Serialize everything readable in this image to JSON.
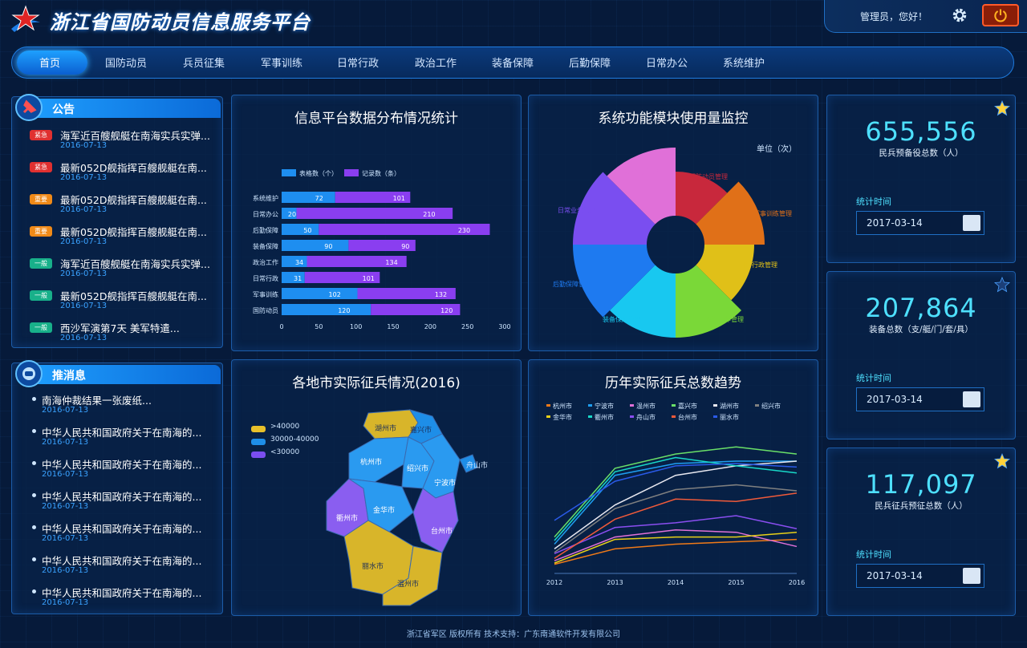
{
  "header": {
    "title": "浙江省国防动员信息服务平台",
    "greeting": "管理员，您好！"
  },
  "nav": {
    "items": [
      "首页",
      "国防动员",
      "兵员征集",
      "军事训练",
      "日常行政",
      "政治工作",
      "装备保障",
      "后勤保障",
      "日常办公",
      "系统维护"
    ]
  },
  "notices": {
    "title": "公告",
    "items": [
      {
        "badge": "紧急",
        "badge_color": "#e03030",
        "title": "海军近百艘舰艇在南海实兵实弹...",
        "date": "2016-07-13"
      },
      {
        "badge": "紧急",
        "badge_color": "#e03030",
        "title": "最新052D舰指挥百艘舰艇在南...",
        "date": "2016-07-13"
      },
      {
        "badge": "重要",
        "badge_color": "#f08a18",
        "title": "最新052D舰指挥百艘舰艇在南...",
        "date": "2016-07-13"
      },
      {
        "badge": "重要",
        "badge_color": "#f08a18",
        "title": "最新052D舰指挥百艘舰艇在南...",
        "date": "2016-07-13"
      },
      {
        "badge": "一般",
        "badge_color": "#18b08a",
        "title": "海军近百艘舰艇在南海实兵实弹...",
        "date": "2016-07-13"
      },
      {
        "badge": "一般",
        "badge_color": "#18b08a",
        "title": "最新052D舰指挥百艘舰艇在南...",
        "date": "2016-07-13"
      },
      {
        "badge": "一般",
        "badge_color": "#18b08a",
        "title": "西沙军演第7天 美军特遣...",
        "date": "2016-07-13"
      }
    ]
  },
  "push": {
    "title": "推消息",
    "items": [
      {
        "title": "南海仲裁结果一张废纸...",
        "date": "2016-07-13"
      },
      {
        "title": "中华人民共和国政府关于在南海的...",
        "date": "2016-07-13"
      },
      {
        "title": "中华人民共和国政府关于在南海的...",
        "date": "2016-07-13"
      },
      {
        "title": "中华人民共和国政府关于在南海的...",
        "date": "2016-07-13"
      },
      {
        "title": "中华人民共和国政府关于在南海的...",
        "date": "2016-07-13"
      },
      {
        "title": "中华人民共和国政府关于在南海的...",
        "date": "2016-07-13"
      },
      {
        "title": "中华人民共和国政府关于在南海的...",
        "date": "2016-07-13"
      }
    ]
  },
  "panels": {
    "bar_title": "信息平台数据分布情况统计",
    "rose_title": "系统功能模块使用量监控",
    "rose_unit": "单位（次）",
    "map_title": "各地市实际征兵情况(2016)",
    "line_title": "历年实际征兵总数趋势"
  },
  "stats": [
    {
      "value": "655,556",
      "label": "民兵预备役总数（人）",
      "time_label": "统计时间",
      "date": "2017-03-14",
      "star_color": "#ffd23a"
    },
    {
      "value": "207,864",
      "label": "装备总数（支/艇/门/套/具）",
      "time_label": "统计时间",
      "date": "2017-03-14",
      "star_color": "#1c3f78"
    },
    {
      "value": "117,097",
      "label": "民兵征兵预征总数（人）",
      "time_label": "统计时间",
      "date": "2017-03-14",
      "star_color": "#ffd23a"
    }
  ],
  "map": {
    "legend": [
      {
        "label": ">40000",
        "color": "#e8c02a"
      },
      {
        "label": "30000-40000",
        "color": "#1e8ee8"
      },
      {
        "label": "<30000",
        "color": "#7a4ef0"
      }
    ],
    "cities": [
      {
        "name": "湖州市",
        "color": "#d8b52a"
      },
      {
        "name": "嘉兴市",
        "color": "#1e8ee8"
      },
      {
        "name": "舟山市",
        "color": "#1e8ee8"
      },
      {
        "name": "杭州市",
        "color": "#1e8ee8"
      },
      {
        "name": "绍兴市",
        "color": "#1e8ee8"
      },
      {
        "name": "宁波市",
        "color": "#1e8ee8"
      },
      {
        "name": "衢州市",
        "color": "#8a5ef0"
      },
      {
        "name": "金华市",
        "color": "#1e8ee8"
      },
      {
        "name": "台州市",
        "color": "#8a5ef0"
      },
      {
        "name": "丽水市",
        "color": "#d8b52a"
      },
      {
        "name": "温州市",
        "color": "#d8b52a"
      }
    ]
  },
  "footer": {
    "text": "浙江省军区 版权所有    技术支持：广东南通软件开发有限公司"
  },
  "chart_data": [
    {
      "type": "bar",
      "title": "信息平台数据分布情况统计",
      "categories": [
        "系统维护",
        "日常办公",
        "后勤保障",
        "装备保障",
        "政治工作",
        "日常行政",
        "军事训练",
        "国防动员"
      ],
      "series": [
        {
          "name": "表格数（个）",
          "color": "#1e8ef0",
          "values": [
            72,
            20,
            50,
            90,
            34,
            31,
            102,
            120
          ]
        },
        {
          "name": "记录数（条）",
          "color": "#8a3ef0",
          "values": [
            101,
            210,
            230,
            90,
            134,
            101,
            132,
            120
          ]
        }
      ],
      "stacked": true,
      "xlim": [
        0,
        300
      ],
      "xticks": [
        0,
        50,
        100,
        150,
        200,
        250,
        300
      ]
    },
    {
      "type": "pie",
      "title": "系统功能模块使用量监控",
      "unit": "单位（次）",
      "rose": true,
      "categories": [
        "国防动员管理",
        "军事训练管理",
        "日常行政管理",
        "政治工作管理",
        "装备保障管理",
        "后勤保障管理",
        "日常业务管理",
        "系统维护管理"
      ],
      "values": [
        55,
        75,
        62,
        80,
        80,
        92,
        92,
        85
      ],
      "colors": [
        "#c8283c",
        "#e07018",
        "#e0c018",
        "#7ad838",
        "#18c8f0",
        "#1e7af0",
        "#7a4ef0",
        "#e070d8"
      ]
    },
    {
      "type": "line",
      "title": "历年实际征兵总数趋势",
      "x": [
        "2012",
        "2013",
        "2014",
        "2015",
        "2016"
      ],
      "ylim": [
        0,
        100
      ],
      "series": [
        {
          "name": "杭州市",
          "color": "#f07a18",
          "values": [
            5,
            18,
            22,
            24,
            26
          ]
        },
        {
          "name": "宁波市",
          "color": "#1e9ef0",
          "values": [
            22,
            80,
            90,
            92,
            92
          ]
        },
        {
          "name": "温州市",
          "color": "#e070d8",
          "values": [
            8,
            28,
            34,
            32,
            20
          ]
        },
        {
          "name": "嘉兴市",
          "color": "#6ae068",
          "values": [
            28,
            86,
            98,
            104,
            98
          ]
        },
        {
          "name": "湖州市",
          "color": "#e8e8f0",
          "values": [
            18,
            55,
            80,
            88,
            92
          ]
        },
        {
          "name": "绍兴市",
          "color": "#808080",
          "values": [
            15,
            52,
            68,
            72,
            67
          ]
        },
        {
          "name": "金华市",
          "color": "#e8d018",
          "values": [
            6,
            26,
            28,
            28,
            32
          ]
        },
        {
          "name": "衢州市",
          "color": "#18d8c8",
          "values": [
            25,
            83,
            95,
            88,
            82
          ]
        },
        {
          "name": "舟山市",
          "color": "#8a4ef0",
          "values": [
            14,
            36,
            40,
            46,
            35
          ]
        },
        {
          "name": "台州市",
          "color": "#f05a3a",
          "values": [
            10,
            43,
            60,
            58,
            65
          ]
        },
        {
          "name": "丽水市",
          "color": "#2a5ae8",
          "values": [
            42,
            75,
            88,
            90,
            87
          ]
        }
      ]
    }
  ]
}
